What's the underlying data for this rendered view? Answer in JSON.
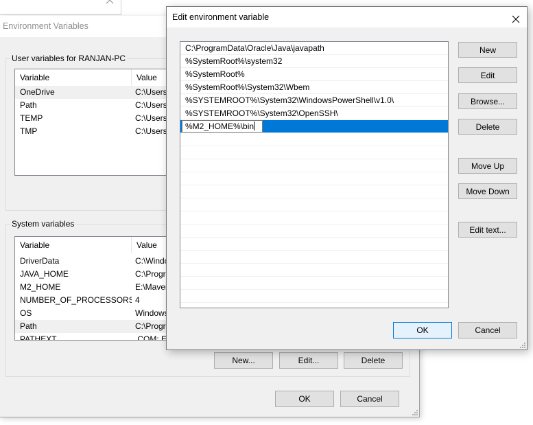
{
  "background_window": {
    "close_icon": "close-icon"
  },
  "env_window": {
    "title": "Environment Variables",
    "user_group": {
      "label": "User variables for RANJAN-PC",
      "columns": [
        "Variable",
        "Value"
      ],
      "rows": [
        {
          "variable": "OneDrive",
          "value": "C:\\Users\\"
        },
        {
          "variable": "Path",
          "value": "C:\\Users\\"
        },
        {
          "variable": "TEMP",
          "value": "C:\\Users\\"
        },
        {
          "variable": "TMP",
          "value": "C:\\Users\\"
        }
      ]
    },
    "system_group": {
      "label": "System variables",
      "columns": [
        "Variable",
        "Value"
      ],
      "rows": [
        {
          "variable": "DriverData",
          "value": "C:\\Windo"
        },
        {
          "variable": "JAVA_HOME",
          "value": "C:\\Progr"
        },
        {
          "variable": "M2_HOME",
          "value": "E:\\Maver"
        },
        {
          "variable": "NUMBER_OF_PROCESSORS",
          "value": "4"
        },
        {
          "variable": "OS",
          "value": "Windows"
        },
        {
          "variable": "Path",
          "value": "C:\\Progr"
        },
        {
          "variable": "PATHEXT",
          "value": ".COM;.E"
        }
      ],
      "buttons": {
        "new": "New...",
        "edit": "Edit...",
        "delete": "Delete"
      }
    },
    "ok_label": "OK",
    "cancel_label": "Cancel"
  },
  "edit_dialog": {
    "title": "Edit environment variable",
    "entries": [
      "C:\\ProgramData\\Oracle\\Java\\javapath",
      "%SystemRoot%\\system32",
      "%SystemRoot%",
      "%SystemRoot%\\System32\\Wbem",
      "%SYSTEMROOT%\\System32\\WindowsPowerShell\\v1.0\\",
      "%SYSTEMROOT%\\System32\\OpenSSH\\"
    ],
    "editing_value": "%M2_HOME%\\bin",
    "buttons": {
      "new": "New",
      "edit": "Edit",
      "browse": "Browse...",
      "delete": "Delete",
      "move_up": "Move Up",
      "move_down": "Move Down",
      "edit_text": "Edit text..."
    },
    "ok_label": "OK",
    "cancel_label": "Cancel",
    "selection_color": "#0078d7"
  }
}
